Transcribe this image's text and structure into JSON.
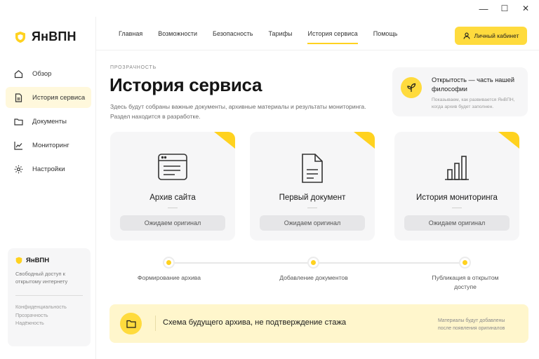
{
  "window": {
    "minimize": "—",
    "maximize": "☐",
    "close": "✕"
  },
  "brand": {
    "name": "ЯнВПН",
    "accent": "#ffd21f"
  },
  "sidebar": {
    "items": [
      {
        "label": "Обзор",
        "icon": "home-icon",
        "active": false
      },
      {
        "label": "История сервиса",
        "icon": "document-icon",
        "active": true
      },
      {
        "label": "Документы",
        "icon": "folder-icon",
        "active": false
      },
      {
        "label": "Мониторинг",
        "icon": "chart-line-icon",
        "active": false
      },
      {
        "label": "Настройки",
        "icon": "gear-icon",
        "active": false
      }
    ],
    "card": {
      "brand": "ЯнВПН",
      "tagline": "Свободный доступ к открытому интернету",
      "links": [
        "Конфиденциальность",
        "Прозрачность",
        "Надёжность"
      ]
    }
  },
  "topnav": {
    "items": [
      {
        "label": "Главная",
        "active": false
      },
      {
        "label": "Возможности",
        "active": false
      },
      {
        "label": "Безопасность",
        "active": false
      },
      {
        "label": "Тарифы",
        "active": false
      },
      {
        "label": "История сервиса",
        "active": true
      },
      {
        "label": "Помощь",
        "active": false
      }
    ],
    "cabinet": "Личный кабинет"
  },
  "main": {
    "eyebrow": "ПРОЗРАЧНОСТЬ",
    "title": "История сервиса",
    "description": "Здесь будут собраны важные документы, архивные материалы и результаты мониторинга. Раздел находится в разработке."
  },
  "philosophy": {
    "title": "Открытость — часть нашей философии",
    "subtitle": "Показываем, как развивается ЯнВПН, когда архив будет заполнен."
  },
  "cards": [
    {
      "title": "Архив сайта",
      "icon": "browser-window-icon",
      "status": "Ожидаем оригинал"
    },
    {
      "title": "Первый документ",
      "icon": "file-text-icon",
      "status": "Ожидаем оригинал"
    },
    {
      "title": "История мониторинга",
      "icon": "bar-chart-icon",
      "status": "Ожидаем оригинал"
    }
  ],
  "timeline": [
    {
      "label": "Формирование архива"
    },
    {
      "label": "Добавление документов"
    },
    {
      "label": "Публикация в открытом доступе"
    }
  ],
  "banner": {
    "text": "Схема будущего архива, не подтверждение стажа",
    "note": "Материалы будут добавлены после появления оригиналов"
  }
}
